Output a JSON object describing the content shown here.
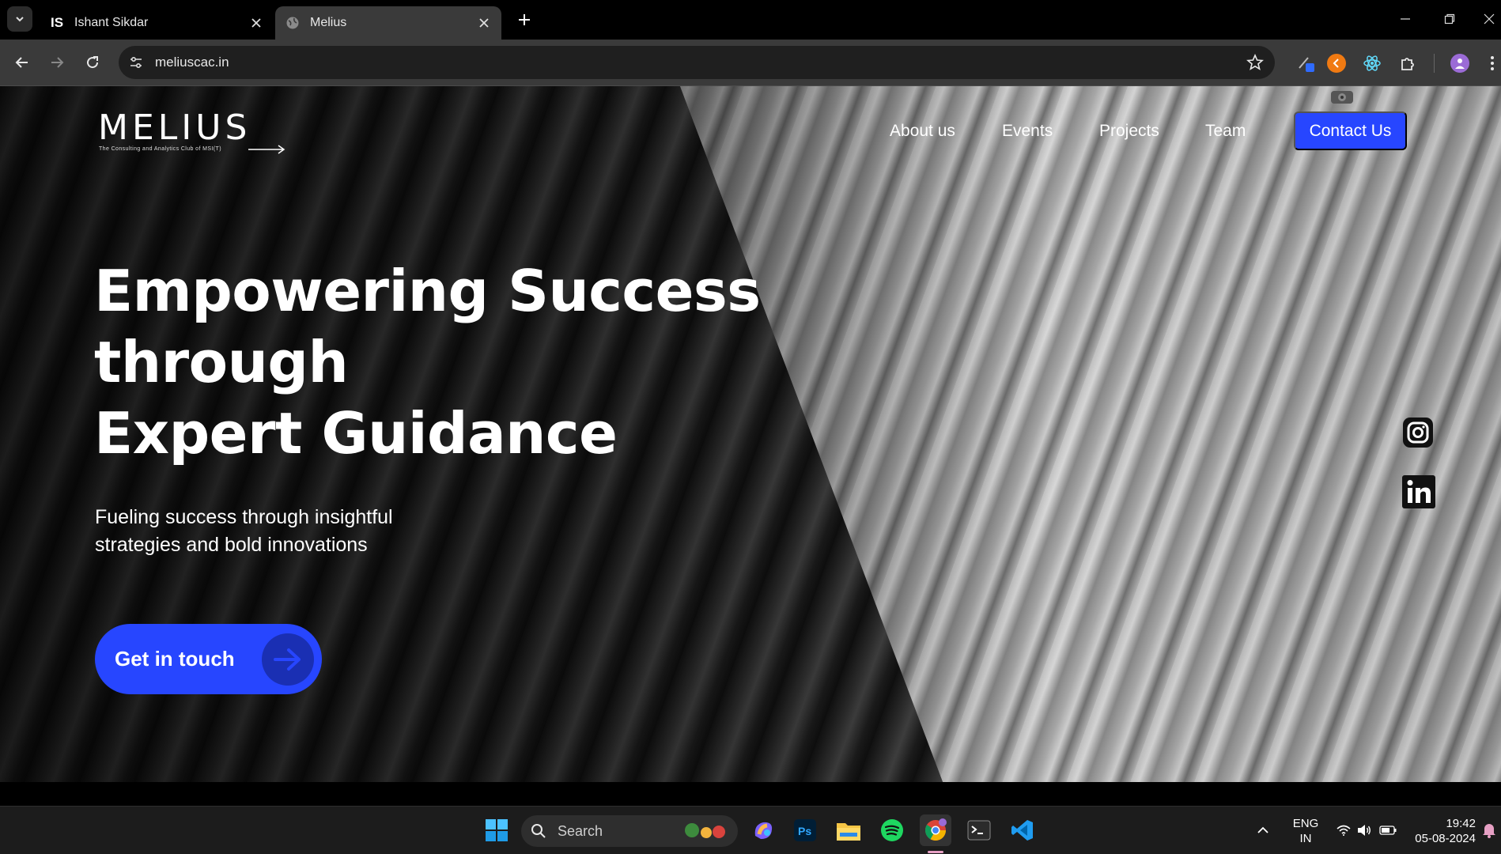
{
  "browser": {
    "tabs": [
      {
        "title": "Ishant Sikdar",
        "favicon": "IS",
        "active": false
      },
      {
        "title": "Melius",
        "favicon": "globe-icon",
        "active": true
      }
    ],
    "url": "meliuscac.in"
  },
  "site": {
    "logo_text": "MELIUS",
    "logo_tagline": "The Consulting and Analytics Club of MSI(T)",
    "nav": [
      {
        "label": "About us"
      },
      {
        "label": "Events"
      },
      {
        "label": "Projects"
      },
      {
        "label": "Team"
      }
    ],
    "contact_label": "Contact Us",
    "hero": {
      "title_lines": [
        "Empowering Success",
        "through",
        "Expert Guidance"
      ],
      "subtitle": "Fueling success through insightful strategies and bold innovations",
      "cta_label": "Get in touch"
    },
    "social": [
      "instagram-icon",
      "linkedin-icon"
    ],
    "accent_color": "#2746ff"
  },
  "taskbar": {
    "search_placeholder": "Search",
    "lang_line1": "ENG",
    "lang_line2": "IN",
    "time": "19:42",
    "date": "05-08-2024"
  }
}
